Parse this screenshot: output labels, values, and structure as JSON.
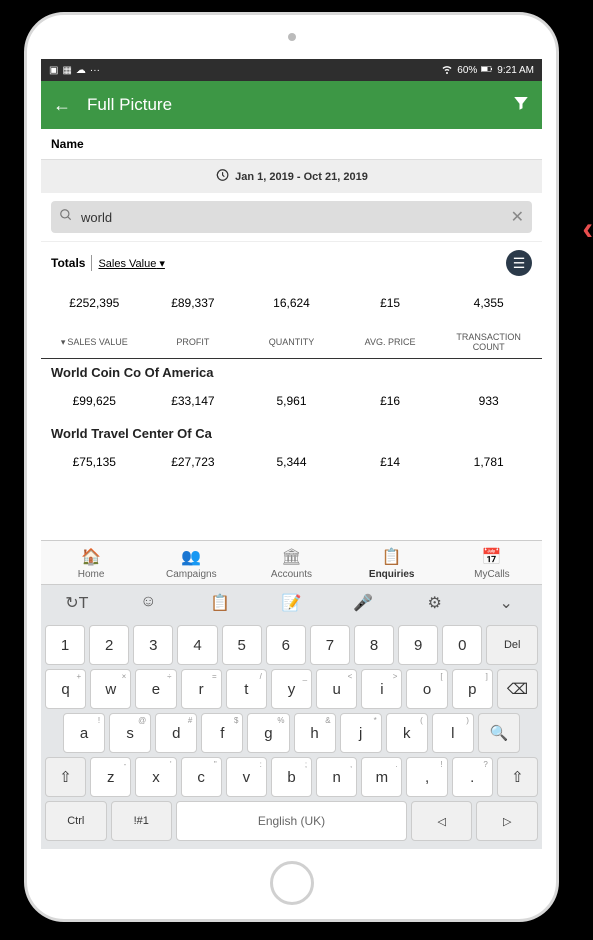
{
  "status": {
    "battery": "60%",
    "time": "9:21 AM"
  },
  "appbar": {
    "title": "Full Picture"
  },
  "nameLabel": "Name",
  "dateRange": "Jan 1, 2019 - Oct 21, 2019",
  "search": {
    "value": "world"
  },
  "totals": {
    "label": "Totals",
    "dropdown": "Sales Value"
  },
  "totalsValues": [
    "£252,395",
    "£89,337",
    "16,624",
    "£15",
    "4,355"
  ],
  "columns": [
    "SALES VALUE",
    "PROFIT",
    "QUANTITY",
    "AVG. PRICE",
    "TRANSACTION COUNT"
  ],
  "rows": [
    {
      "name": "World Coin Co Of America",
      "values": [
        "£99,625",
        "£33,147",
        "5,961",
        "£16",
        "933"
      ]
    },
    {
      "name": "World Travel Center Of Ca",
      "values": [
        "£75,135",
        "£27,723",
        "5,344",
        "£14",
        "1,781"
      ]
    }
  ],
  "nav": [
    {
      "label": "Home",
      "icon": "🏠"
    },
    {
      "label": "Campaigns",
      "icon": "👥"
    },
    {
      "label": "Accounts",
      "icon": "🏛"
    },
    {
      "label": "Enquiries",
      "icon": "📋"
    },
    {
      "label": "MyCalls",
      "icon": "📅"
    }
  ],
  "kbToolbar": [
    "↻T",
    "☺",
    "📋",
    "📝",
    "🎤",
    "⚙",
    "⌄"
  ],
  "keyboard": {
    "row1": [
      "1",
      "2",
      "3",
      "4",
      "5",
      "6",
      "7",
      "8",
      "9",
      "0",
      "Del"
    ],
    "row2": [
      {
        "k": "q",
        "s": "+"
      },
      {
        "k": "w",
        "s": "×"
      },
      {
        "k": "e",
        "s": "÷"
      },
      {
        "k": "r",
        "s": "="
      },
      {
        "k": "t",
        "s": "/"
      },
      {
        "k": "y",
        "s": "_"
      },
      {
        "k": "u",
        "s": "<"
      },
      {
        "k": "i",
        "s": ">"
      },
      {
        "k": "o",
        "s": "["
      },
      {
        "k": "p",
        "s": "]"
      },
      {
        "k": "⌫",
        "s": ""
      }
    ],
    "row3": [
      {
        "k": "a",
        "s": "!"
      },
      {
        "k": "s",
        "s": "@"
      },
      {
        "k": "d",
        "s": "#"
      },
      {
        "k": "f",
        "s": "$"
      },
      {
        "k": "g",
        "s": "%"
      },
      {
        "k": "h",
        "s": "&"
      },
      {
        "k": "j",
        "s": "*"
      },
      {
        "k": "k",
        "s": "("
      },
      {
        "k": "l",
        "s": ")"
      },
      {
        "k": "🔍",
        "s": ""
      }
    ],
    "row4": [
      {
        "k": "⇧",
        "s": ""
      },
      {
        "k": "z",
        "s": "-"
      },
      {
        "k": "x",
        "s": "'"
      },
      {
        "k": "c",
        "s": "\""
      },
      {
        "k": "v",
        "s": ":"
      },
      {
        "k": "b",
        "s": ";"
      },
      {
        "k": "n",
        "s": ","
      },
      {
        "k": "m",
        "s": "."
      },
      {
        "k": ",",
        "s": "!"
      },
      {
        "k": ".",
        "s": "?"
      },
      {
        "k": "⇧",
        "s": ""
      }
    ],
    "row5": {
      "ctrl": "Ctrl",
      "sym": "!#1",
      "space": "English (UK)",
      "left": "◁",
      "right": "▷"
    }
  }
}
